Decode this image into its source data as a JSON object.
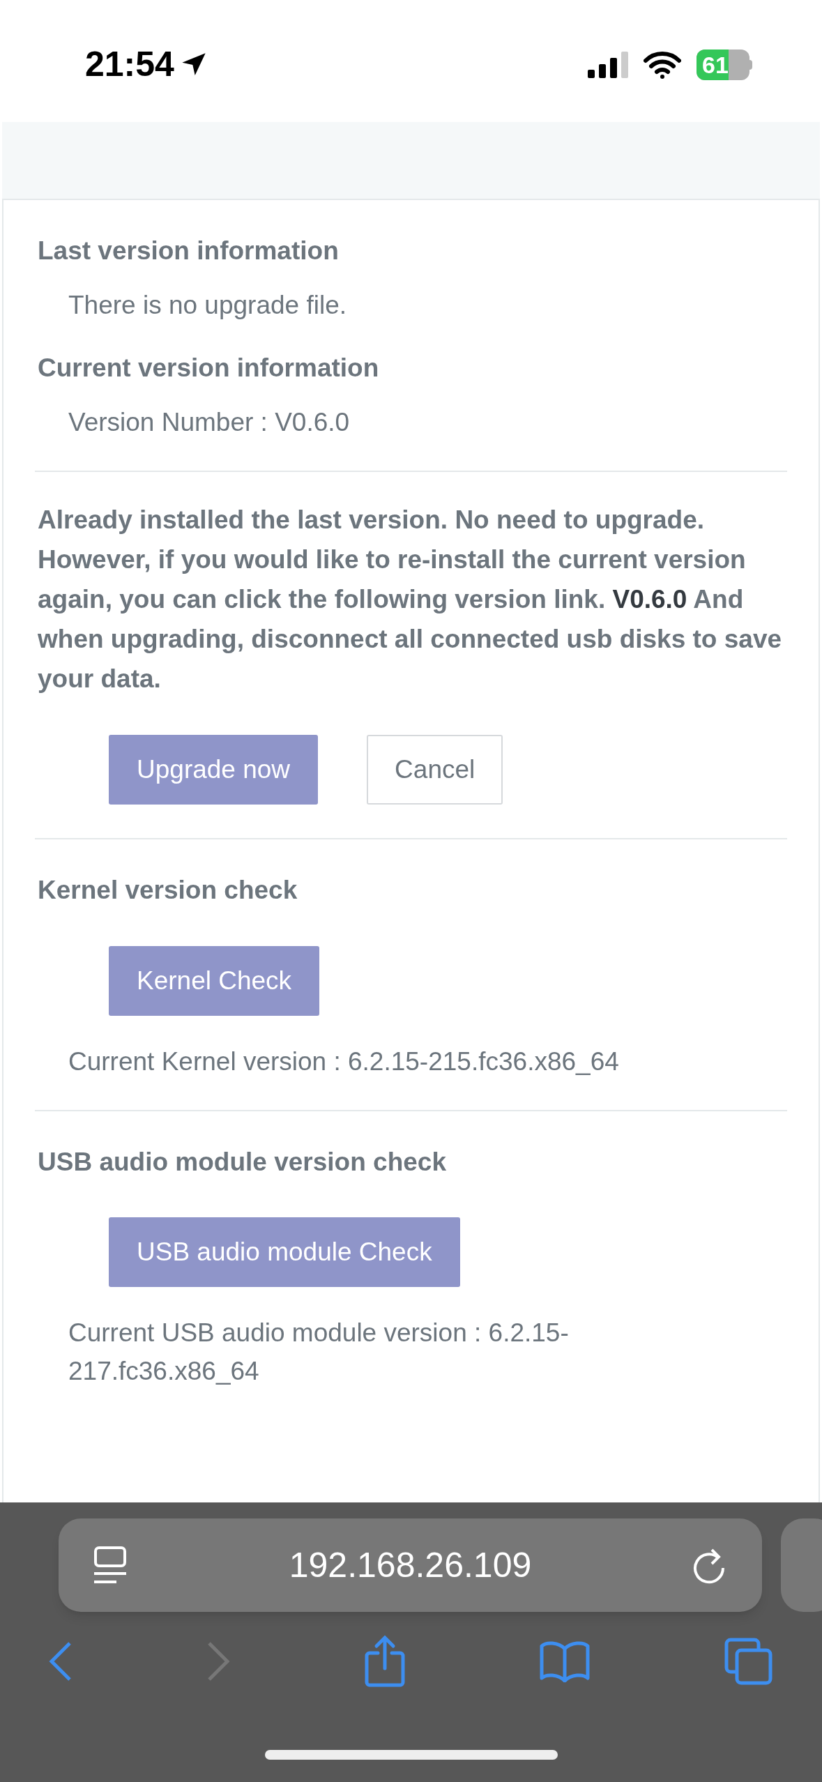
{
  "status_bar": {
    "time": "21:54",
    "battery": "61"
  },
  "sections": [
    {
      "kind": "info",
      "title": "Last version information",
      "lines": [
        "There is no upgrade file."
      ]
    },
    {
      "kind": "info",
      "title": "Current version information",
      "lines": [
        "Version Number : V0.6.0"
      ]
    },
    {
      "kind": "notice",
      "text": "Already installed the last version. No need to upgrade. However, if you would like to re-install the current version again, you can click the following version link. **V0.6.0** And when upgrading, disconnect all connected usb disks to save your data.",
      "buttons": [
        {
          "label": "Upgrade now",
          "kind": "primary"
        },
        {
          "label": "Cancel",
          "kind": "secondary"
        }
      ]
    },
    {
      "kind": "check",
      "title": "Kernel version check",
      "buttons": [
        {
          "label": "Kernel Check",
          "kind": "primary"
        }
      ],
      "lines": [
        "Current Kernel version : 6.2.15-215.fc36.x86_64"
      ]
    },
    {
      "kind": "check",
      "title": "USB audio module version check",
      "buttons": [
        {
          "label": "USB audio module Check",
          "kind": "primary"
        }
      ],
      "lines": [
        "Current USB audio module version : 6.2.15-217.fc36.x86_64"
      ]
    }
  ],
  "browser": {
    "address": "192.168.26.109",
    "back_enabled": true,
    "forward_enabled": false
  }
}
